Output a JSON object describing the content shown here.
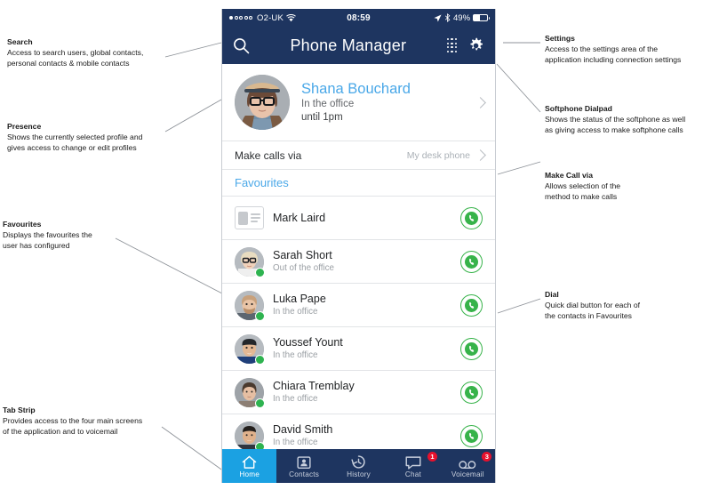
{
  "phone": {
    "status_bar": {
      "carrier": "O2-UK",
      "signal_dots_filled": 1,
      "signal_dots_total": 5,
      "wifi_icon": "wifi-icon",
      "time": "08:59",
      "location_icon": "location-arrow-icon",
      "bluetooth_icon": "bluetooth-icon",
      "battery_text": "49%",
      "battery_level": 49
    },
    "nav": {
      "title": "Phone Manager",
      "search_icon": "search-icon",
      "dialpad_icon": "dialpad-icon",
      "settings_icon": "gear-icon"
    },
    "profile": {
      "name": "Shana Bouchard",
      "status": "In the office",
      "until": "until 1pm",
      "chevron_icon": "chevron-right-icon"
    },
    "make_calls_via": {
      "label": "Make calls via",
      "value": "My desk phone",
      "chevron_icon": "chevron-right-icon"
    },
    "favourites": {
      "header": "Favourites",
      "contacts": [
        {
          "name": "Mark Laird",
          "status": "",
          "avatar": "placeholder-card",
          "presence": "none",
          "call_icon": "call-icon"
        },
        {
          "name": "Sarah Short",
          "status": "Out of the office",
          "avatar": "photo-female-blonde",
          "presence": "available",
          "call_icon": "call-icon"
        },
        {
          "name": "Luka Pape",
          "status": "In the office",
          "avatar": "photo-male-beard",
          "presence": "available",
          "call_icon": "call-icon"
        },
        {
          "name": "Youssef Yount",
          "status": "In the office",
          "avatar": "photo-male-cap",
          "presence": "available",
          "call_icon": "call-icon"
        },
        {
          "name": "Chiara Tremblay",
          "status": "In the office",
          "avatar": "photo-female-dark",
          "presence": "available",
          "call_icon": "call-icon"
        },
        {
          "name": "David Smith",
          "status": "In the office",
          "avatar": "photo-male-smile",
          "presence": "available",
          "call_icon": "call-icon"
        }
      ]
    },
    "tabs": [
      {
        "label": "Home",
        "icon": "home-icon",
        "active": true,
        "badge": ""
      },
      {
        "label": "Contacts",
        "icon": "contacts-icon",
        "active": false,
        "badge": ""
      },
      {
        "label": "History",
        "icon": "history-icon",
        "active": false,
        "badge": ""
      },
      {
        "label": "Chat",
        "icon": "chat-icon",
        "active": false,
        "badge": "1"
      },
      {
        "label": "Voicemail",
        "icon": "voicemail-icon",
        "active": false,
        "badge": "3"
      }
    ]
  },
  "annotations": {
    "search": {
      "title": "Search",
      "body": "Access to search users, global contacts,\npersonal contacts & mobile contacts"
    },
    "presence": {
      "title": "Presence",
      "body": "Shows the currently selected profile and\ngives access to change or edit profiles"
    },
    "favourites": {
      "title": "Favourites",
      "body": "Displays the favourites the\nuser has configured"
    },
    "tabstrip": {
      "title": "Tab Strip",
      "body": "Provides access to the four main screens\nof the application and to voicemail"
    },
    "settings": {
      "title": "Settings",
      "body": "Access to the settings area of the\napplication including connection settings"
    },
    "dialpad": {
      "title": "Softphone Dialpad",
      "body": "Shows the status of the softphone as well\nas giving access to make softphone calls"
    },
    "makecall": {
      "title": "Make Call via",
      "body": "Allows selection of the\nmethod to make calls"
    },
    "dial": {
      "title": "Dial",
      "body": "Quick dial button for each of\nthe contacts in Favourites"
    }
  },
  "colors": {
    "nav_navy": "#1e3560",
    "accent_blue": "#4aa8e8",
    "tab_active": "#1ba1e2",
    "green": "#37b34a",
    "badge_red": "#e8112d"
  }
}
